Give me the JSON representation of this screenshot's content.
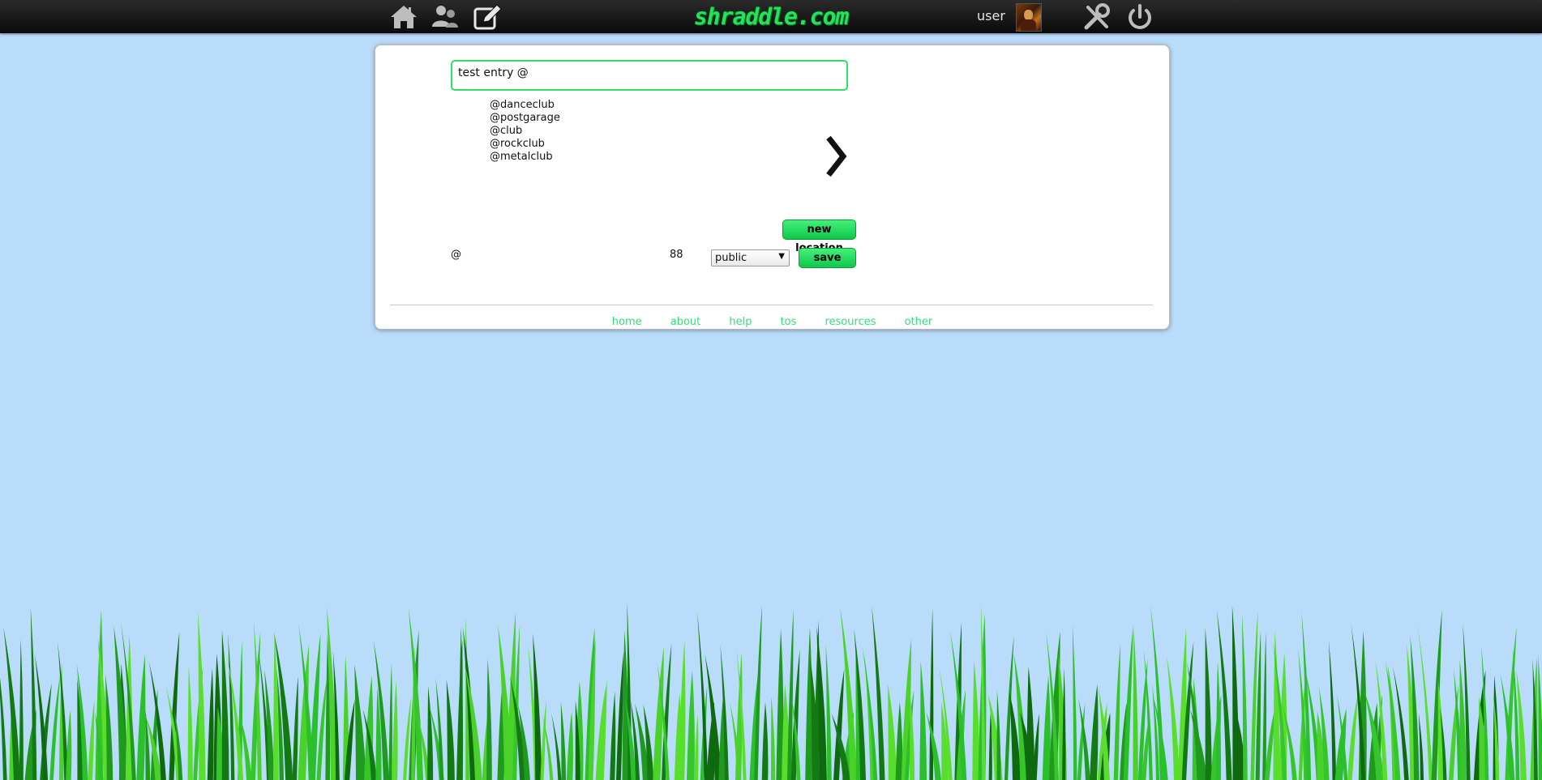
{
  "header": {
    "logo": "shraddle.com",
    "username": "user",
    "icons": [
      "home-icon",
      "friends-icon",
      "edit-icon",
      "settings-icon",
      "power-icon"
    ]
  },
  "composer": {
    "entry_text": "test entry @",
    "suggestions": [
      "@danceclub",
      "@postgarage",
      "@club",
      "@rockclub",
      "@metalclub"
    ],
    "new_location_label": "new location",
    "at_label": "@",
    "char_count": "88",
    "visibility": "public",
    "save_label": "save"
  },
  "footer": {
    "links": [
      "home",
      "about",
      "help",
      "tos",
      "resources",
      "other"
    ]
  },
  "colors": {
    "background": "#badcfb",
    "accent": "#2ee06a",
    "topbar": "#111111"
  }
}
